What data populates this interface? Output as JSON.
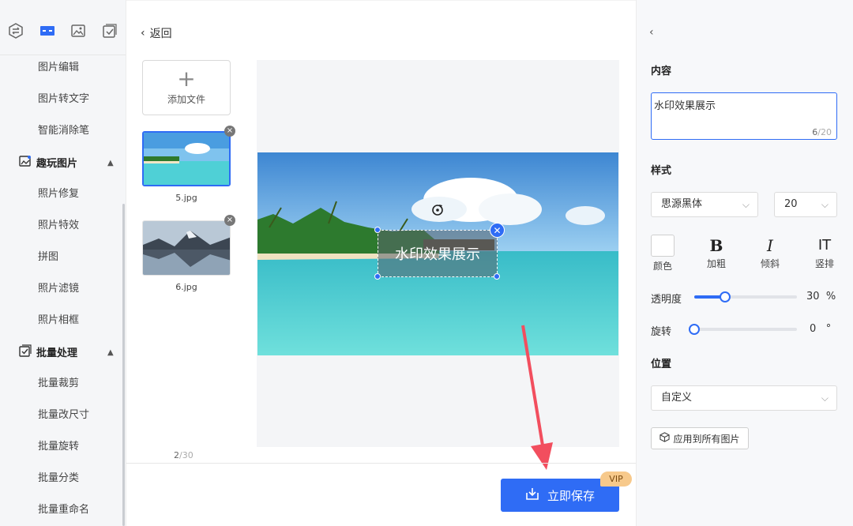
{
  "sidebar": {
    "top_icons": [
      "convert-icon",
      "layout-icon",
      "image-icon",
      "check-icon"
    ],
    "items_top": [
      "图片编辑",
      "图片转文字",
      "智能消除笔"
    ],
    "group_fun": {
      "label": "趣玩图片",
      "items": [
        "照片修复",
        "照片特效",
        "拼图",
        "照片滤镜",
        "照片相框"
      ]
    },
    "group_batch": {
      "label": "批量处理",
      "items": [
        "批量裁剪",
        "批量改尺寸",
        "批量旋转",
        "批量分类",
        "批量重命名"
      ]
    }
  },
  "header": {
    "back_label": "返回"
  },
  "files": {
    "add_label": "添加文件",
    "items": [
      {
        "name": "5.jpg",
        "selected": true
      },
      {
        "name": "6.jpg",
        "selected": false
      }
    ],
    "count_current": "2",
    "count_total": "/30"
  },
  "canvas": {
    "watermark_text": "水印效果展示"
  },
  "footer": {
    "save_label": "立即保存",
    "vip_label": "VIP"
  },
  "panel": {
    "content_title": "内容",
    "content_value": "水印效果展示",
    "content_count": "6",
    "content_max": "/20",
    "style_title": "样式",
    "font_family": "思源黑体",
    "font_size": "20",
    "style_buttons": {
      "color": "颜色",
      "bold": "加粗",
      "italic": "倾斜",
      "vertical": "竖排"
    },
    "bold_glyph": "B",
    "italic_glyph": "I",
    "vertical_glyph": "IT",
    "opacity_label": "透明度",
    "opacity_value": "30",
    "opacity_unit": "%",
    "opacity_fraction": 0.3,
    "rotate_label": "旋转",
    "rotate_value": "0",
    "rotate_unit": "°",
    "rotate_fraction": 0,
    "position_title": "位置",
    "position_value": "自定义",
    "apply_label": "应用到所有图片"
  },
  "colors": {
    "accent": "#2f6cf5",
    "vip": "#f7c98b"
  }
}
